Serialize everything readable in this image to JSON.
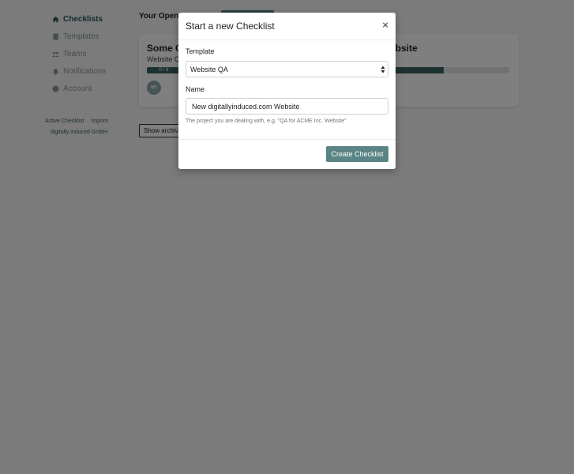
{
  "sidebar": {
    "items": [
      {
        "label": "Checklists",
        "icon": "home-icon",
        "active": true
      },
      {
        "label": "Templates",
        "icon": "document-icon",
        "active": false
      },
      {
        "label": "Teams",
        "icon": "users-icon",
        "active": false
      },
      {
        "label": "Notifications",
        "icon": "bell-icon",
        "active": false
      },
      {
        "label": "Account",
        "icon": "user-circle-icon",
        "active": false
      }
    ]
  },
  "footer": {
    "link_active_checklist": "Active Checklist",
    "link_imprint": "Imprint",
    "company": "digitally induced GmbH"
  },
  "main": {
    "title": "Your Open C",
    "card": {
      "title": "Some C",
      "title_right": "ebsite",
      "subtitle": "Website C",
      "progress_left_label": "0 / 6",
      "progress_right_fraction": 0.45,
      "avatar_initials": "MS"
    },
    "show_archived_label": "Show archived"
  },
  "modal": {
    "title": "Start a new Checklist",
    "close_symbol": "×",
    "template_label": "Template",
    "template_value": "Website QA",
    "name_label": "Name",
    "name_value": "New digitallyinduced.com Website",
    "help_text": "The project you are dealing with, e.g. \"QA for ACME Inc. Website\"",
    "create_button": "Create Checklist"
  },
  "colors": {
    "accent": "#3b6263",
    "button": "#5a8485",
    "overlay": "rgba(0,0,0,0.5)"
  }
}
